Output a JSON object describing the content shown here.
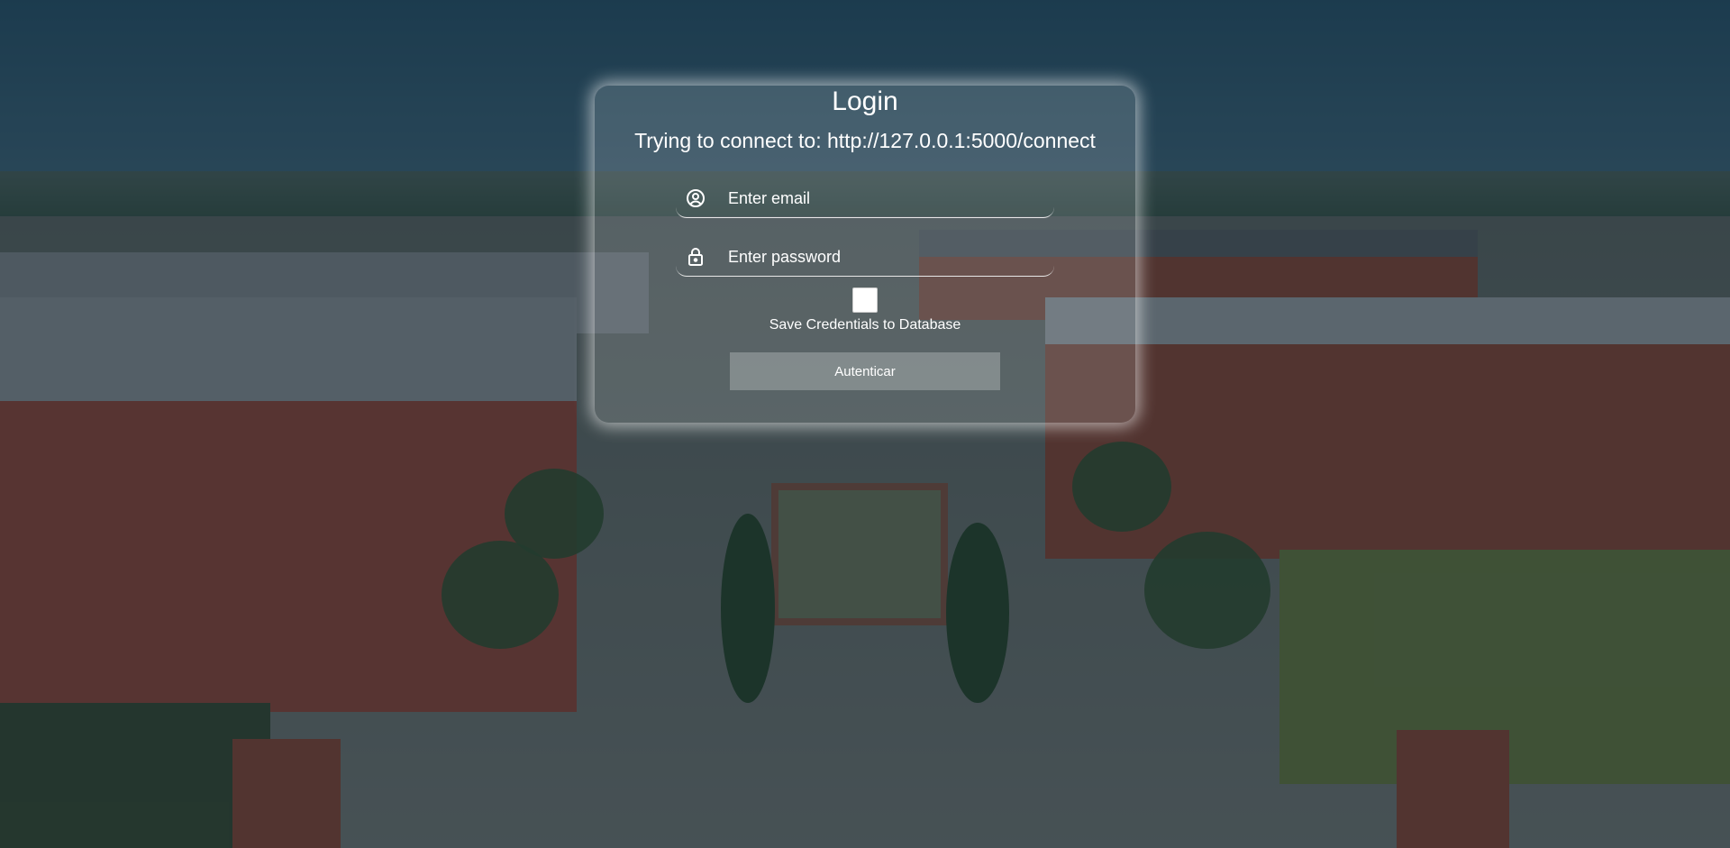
{
  "login": {
    "title": "Login",
    "connect_text": "Trying to connect to: http://127.0.0.1:5000/connect",
    "email": {
      "placeholder": "Enter email",
      "value": "",
      "icon": "user-circle-icon"
    },
    "password": {
      "placeholder": "Enter password",
      "value": "",
      "icon": "lock-icon"
    },
    "save_credentials": {
      "label": "Save Credentials to Database",
      "checked": false
    },
    "submit_label": "Autenticar"
  },
  "colors": {
    "overlay": "#0f2332",
    "card_glow": "#ffffff",
    "text": "#ffffff"
  }
}
